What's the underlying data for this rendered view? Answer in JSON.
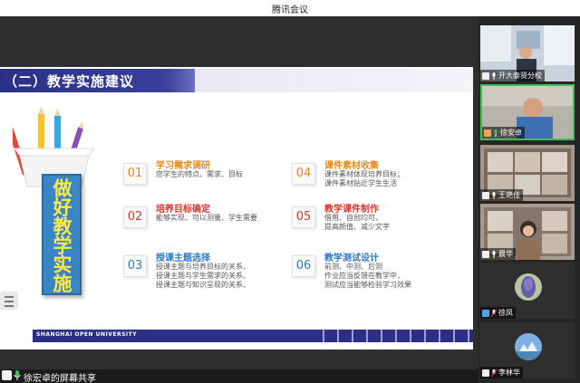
{
  "app": {
    "title": "腾讯会议"
  },
  "slide": {
    "title": "（二）教学实施建议",
    "vertical_text": "做好教学实施",
    "footer": "SHANGHAI OPEN UNIVERSITY",
    "items": [
      {
        "num": "01",
        "title": "学习需求调研",
        "desc": [
          "您学生的特点、需求、目标"
        ]
      },
      {
        "num": "02",
        "title": "培养目标确定",
        "desc": [
          "能够实现、可以测量、学生需要"
        ]
      },
      {
        "num": "03",
        "title": "授课主题选择",
        "desc": [
          "授课主题与培养目标的关系、",
          "授课主题与学生需求的关系、",
          "授课主题与知识呈现的关系、"
        ]
      },
      {
        "num": "04",
        "title": "课件素材收集",
        "desc": [
          "课件素材体现培养目标；",
          "课件素材贴近学生生活"
        ]
      },
      {
        "num": "05",
        "title": "教学课件制作",
        "desc": [
          "借用、自创均可，",
          "提高颜值、减少文字"
        ]
      },
      {
        "num": "06",
        "title": "教学测试设计",
        "desc": [
          "前测、中测、后测",
          "作业应当反馈在教学中，",
          "测试应当能够检验学习效果"
        ]
      }
    ]
  },
  "share": {
    "label": "徐宏卓的屏幕共享"
  },
  "participants": [
    {
      "name": "开大泰贤分校"
    },
    {
      "name": "徐安卓"
    },
    {
      "name": "王艳佳"
    },
    {
      "name": "晨华"
    },
    {
      "name": "徐凤"
    },
    {
      "name": "李林华"
    }
  ],
  "colors": {
    "accent_green": "#3fbf5a",
    "slide_navy": "#2b2f86",
    "vertical_box": "#3a86c4",
    "vertical_text": "#ffe94a"
  }
}
